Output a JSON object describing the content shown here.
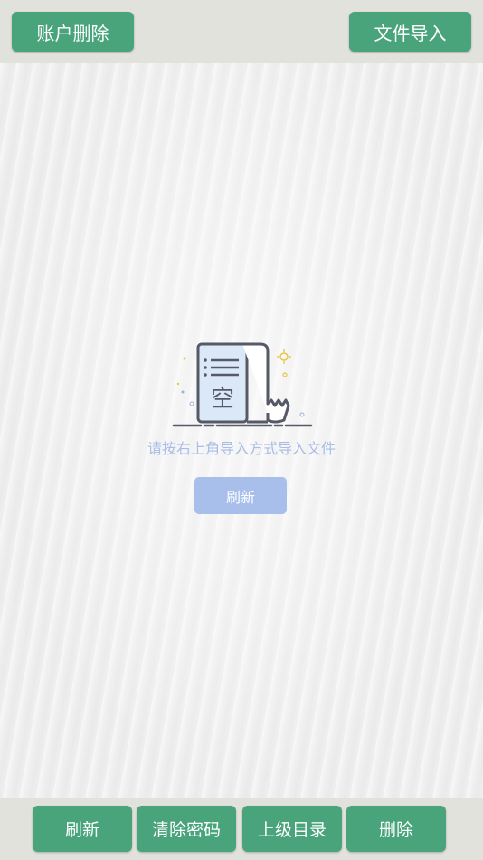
{
  "header": {
    "account_delete_label": "账户删除",
    "file_import_label": "文件导入"
  },
  "empty_state": {
    "icon_glyph": "空",
    "icon_name": "empty-document-icon",
    "message": "请按右上角导入方式导入文件",
    "refresh_label": "刷新"
  },
  "footer": {
    "buttons": [
      {
        "label": "刷新"
      },
      {
        "label": "清除密码"
      },
      {
        "label": "上级目录"
      },
      {
        "label": "删除"
      }
    ]
  },
  "colors": {
    "primary_green": "#49a47b",
    "bar_background": "#e2e2dd",
    "empty_text": "#a9bde6",
    "refresh_button": "#a7bfea",
    "icon_stroke": "#555a66",
    "icon_fill": "#dbe8f7"
  }
}
